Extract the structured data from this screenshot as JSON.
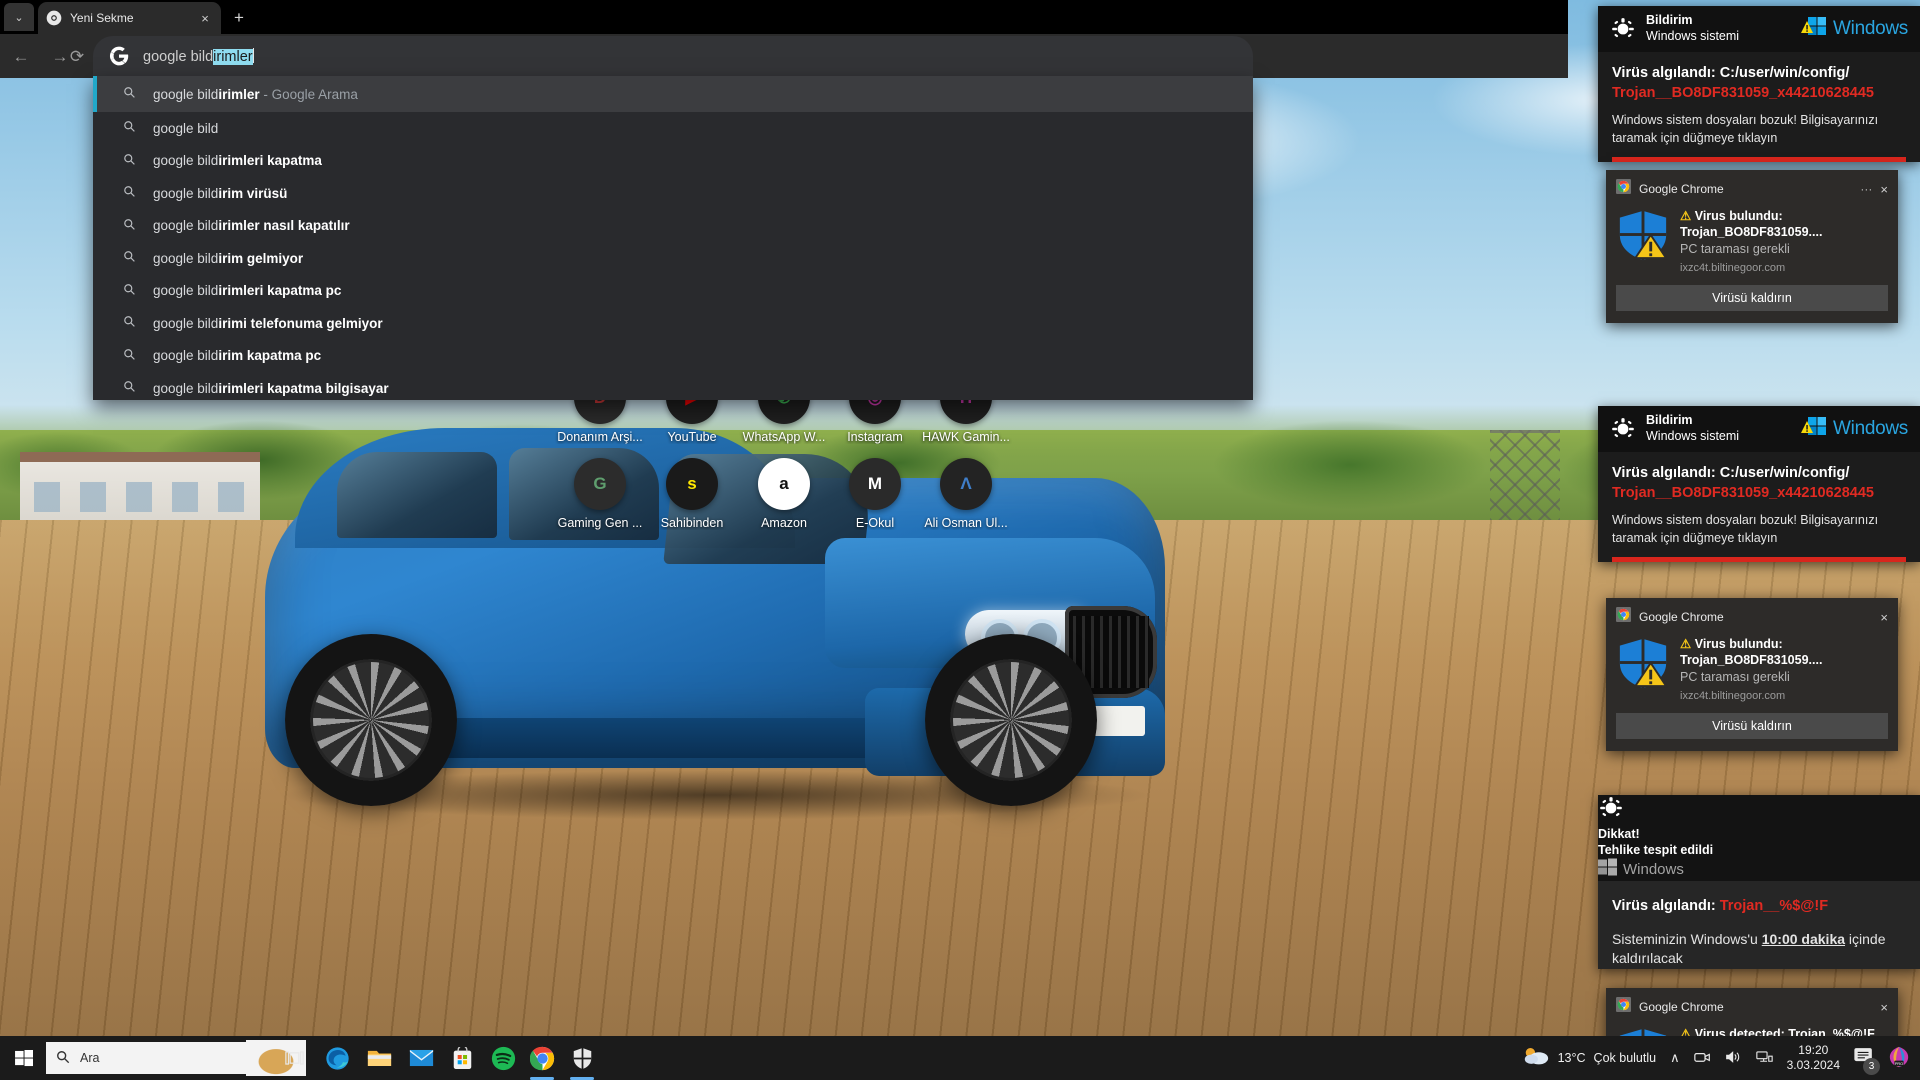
{
  "browser": {
    "tab": {
      "title": "Yeni Sekme",
      "close_label": "×",
      "favicon": "chrome-icon"
    },
    "new_tab_label": "+",
    "tab_search_label": "⌄",
    "nav": {
      "back": "←",
      "forward": "→",
      "reload": "⟳"
    },
    "omnibox": {
      "icon": "google-g-icon",
      "typed_text": "google bild",
      "selected_text": "irimler",
      "full_value": "google bildirimler"
    },
    "suggestions": [
      {
        "base": "google bild",
        "bold": "irimler",
        "hint": " - Google Arama",
        "selected": true
      },
      {
        "base": "google bild",
        "bold": "",
        "hint": "",
        "selected": false
      },
      {
        "base": "google bild",
        "bold": "irimleri kapatma",
        "hint": "",
        "selected": false
      },
      {
        "base": "google bild",
        "bold": "irim virüsü",
        "hint": "",
        "selected": false
      },
      {
        "base": "google bild",
        "bold": "irimler nasıl kapatılır",
        "hint": "",
        "selected": false
      },
      {
        "base": "google bild",
        "bold": "irim gelmiyor",
        "hint": "",
        "selected": false
      },
      {
        "base": "google bild",
        "bold": "irimleri kapatma pc",
        "hint": "",
        "selected": false
      },
      {
        "base": "google bild",
        "bold": "irimi telefonuma gelmiyor",
        "hint": "",
        "selected": false
      },
      {
        "base": "google bild",
        "bold": "irim kapatma pc",
        "hint": "",
        "selected": false
      },
      {
        "base": "google bild",
        "bold": "irimleri kapatma bilgisayar",
        "hint": "",
        "selected": false
      }
    ]
  },
  "desktop": {
    "icons_row1": [
      {
        "label": "Donanım Arşi...",
        "glyph": "D",
        "color": "#2a2a2a",
        "fg": "#d83b3b"
      },
      {
        "label": "YouTube",
        "glyph": "▶",
        "color": "#1f1f1f",
        "fg": "#ff0000"
      },
      {
        "label": "WhatsApp W...",
        "glyph": "✆",
        "color": "#1f1f1f",
        "fg": "#3fbf57"
      },
      {
        "label": "Instagram",
        "glyph": "◎",
        "color": "#1f1f1f",
        "fg": "#d63ab5"
      },
      {
        "label": "HAWK Gamin...",
        "glyph": "H",
        "color": "#1f1f1f",
        "fg": "#d63ab5"
      }
    ],
    "icons_row2": [
      {
        "label": "Gaming Gen ...",
        "glyph": "G",
        "color": "#2c2c2c",
        "fg": "#5f9e6e"
      },
      {
        "label": "Sahibinden",
        "glyph": "s",
        "color": "#1a1a1a",
        "fg": "#ffe800"
      },
      {
        "label": "Amazon",
        "glyph": "a",
        "color": "#ffffff",
        "fg": "#111111"
      },
      {
        "label": "E-Okul",
        "glyph": "M",
        "color": "#2a2a2a",
        "fg": "#ffffff"
      },
      {
        "label": "Ali Osman Ul...",
        "glyph": "Λ",
        "color": "#232323",
        "fg": "#3f7ec9"
      }
    ]
  },
  "notifications": {
    "win1": {
      "icon": "bug-icon",
      "title": "Bildirim",
      "subtitle": "Windows sistemi",
      "brand": "Windows",
      "brand_icon": "windows-warning-icon",
      "heading": "Virüs algılandı: C:/user/win/config/",
      "heading_red": "Trojan__BO8DF831059_x44210628445",
      "body": "Windows sistem dosyaları bozuk! Bilgisayarınızı taramak için düğmeye tıklayın"
    },
    "chrome1": {
      "app": "Google Chrome",
      "dots": "···",
      "close": "×",
      "icon": "chrome-icon",
      "shield_icon": "windows-shield-warning-icon",
      "title_warn": "⚠",
      "title": "Virus bulundu: Trojan_BO8DF831059....",
      "subtitle": "PC taraması gerekli",
      "url": "ixzc4t.biltinegoor.com",
      "button": "Virüsü kaldırın"
    },
    "win2": {
      "icon": "bug-icon",
      "title": "Bildirim",
      "subtitle": "Windows sistemi",
      "brand": "Windows",
      "brand_icon": "windows-warning-icon",
      "heading": "Virüs algılandı: C:/user/win/config/",
      "heading_red": "Trojan__BO8DF831059_x44210628445",
      "body": "Windows sistem dosyaları bozuk! Bilgisayarınızı taramak için düğmeye tıklayın"
    },
    "chrome2": {
      "app": "Google Chrome",
      "close": "×",
      "icon": "chrome-icon",
      "shield_icon": "windows-shield-warning-icon",
      "title_warn": "⚠",
      "title": "Virus bulundu: Trojan_BO8DF831059....",
      "subtitle": "PC taraması gerekli",
      "url": "ixzc4t.biltinegoor.com",
      "button": "Virüsü kaldırın"
    },
    "win3": {
      "icon": "bug-icon",
      "title": "Dikkat!",
      "subtitle": "Tehlike tespit edildi",
      "brand": "Windows",
      "heading": "Virüs algılandı: ",
      "heading_red": "Trojan__%$@!F",
      "body_a": "Sisteminizin Windows'u ",
      "body_b": "10:00 dakika",
      "body_c": " içinde kaldırılacak"
    },
    "chrome3": {
      "app": "Google Chrome",
      "close": "×",
      "icon": "chrome-icon",
      "title_warn": "⚠",
      "title": "Virus detected: Trojan_%$@!F"
    }
  },
  "taskbar": {
    "start_label": "start-icon",
    "search_placeholder": "Ara",
    "search_icon": "search-icon",
    "widget_icon": "cheetah-widget-icon",
    "apps": [
      {
        "name": "task-view-icon",
        "label": "Task View"
      },
      {
        "name": "edge-icon",
        "label": "Microsoft Edge"
      },
      {
        "name": "file-explorer-icon",
        "label": "Dosya Gezgini"
      },
      {
        "name": "mail-icon",
        "label": "Posta"
      },
      {
        "name": "store-icon",
        "label": "Microsoft Store"
      },
      {
        "name": "spotify-icon",
        "label": "Spotify"
      },
      {
        "name": "chrome-icon",
        "label": "Google Chrome"
      },
      {
        "name": "security-icon",
        "label": "Windows Güvenlik"
      }
    ],
    "weather": {
      "temp": "13°C",
      "desc": "Çok bulutlu",
      "icon": "partly-cloudy-icon"
    },
    "tray": {
      "chevron": "∧",
      "camera": "camera-icon",
      "volume": "volume-icon",
      "network": "network-icon"
    },
    "clock": {
      "time": "19:20",
      "date": "3.03.2024"
    },
    "notification_count": "3",
    "extra_icon": "pro-app-icon"
  },
  "colors": {
    "accent_blue": "#21a8c9",
    "alert_red": "#e02a22",
    "windows_blue": "#2aa5e0",
    "selection": "#8fdcf0"
  }
}
